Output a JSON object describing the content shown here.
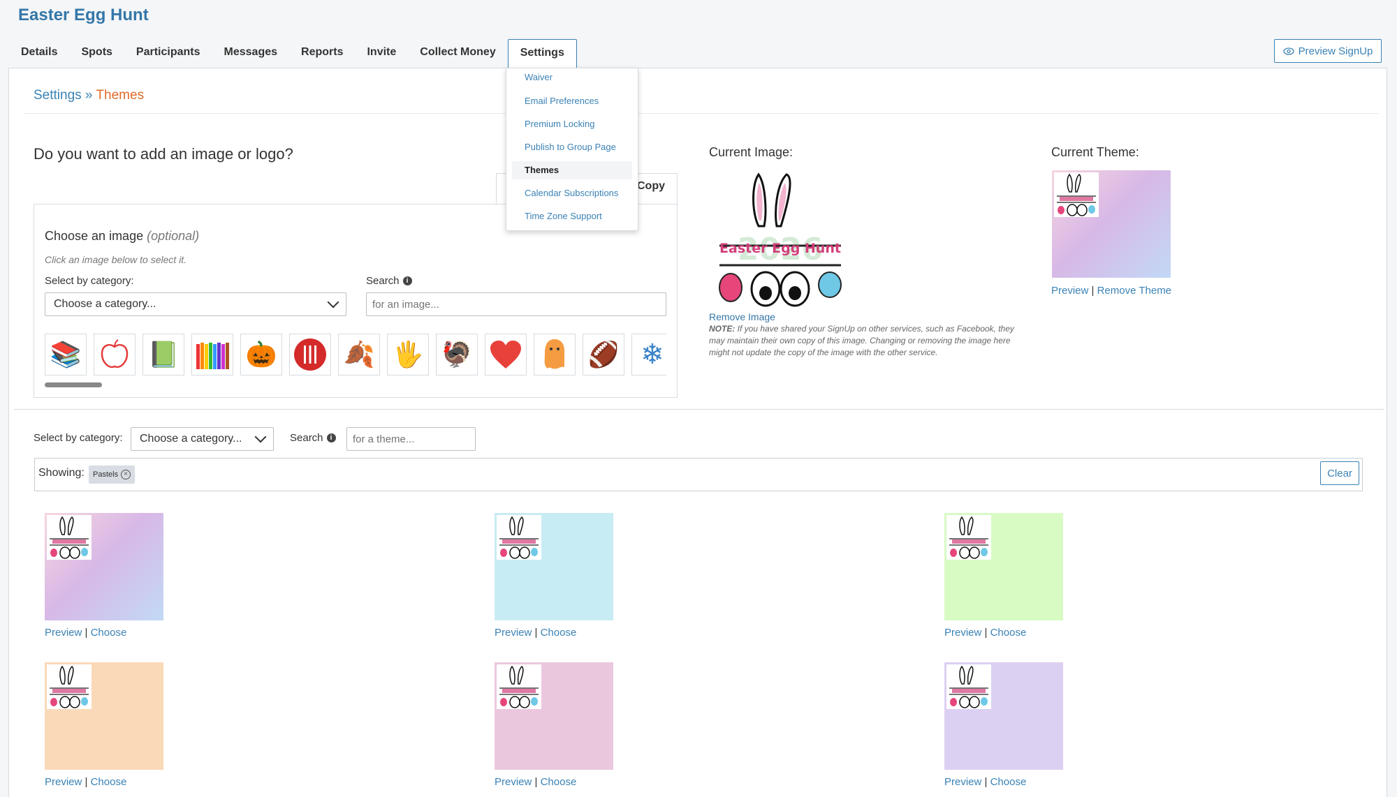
{
  "header": {
    "title": "Easter Egg Hunt",
    "preview_signup": "Preview SignUp"
  },
  "tabs": [
    {
      "label": "Details"
    },
    {
      "label": "Spots"
    },
    {
      "label": "Participants"
    },
    {
      "label": "Messages"
    },
    {
      "label": "Reports"
    },
    {
      "label": "Invite"
    },
    {
      "label": "Collect Money"
    },
    {
      "label": "Settings",
      "active": true
    }
  ],
  "settings_menu": [
    {
      "label": "Waiver"
    },
    {
      "label": "Email Preferences"
    },
    {
      "label": "Premium Locking"
    },
    {
      "label": "Publish to Group Page"
    },
    {
      "label": "Themes",
      "active": true
    },
    {
      "label": "Calendar Subscriptions"
    },
    {
      "label": "Time Zone Support"
    }
  ],
  "breadcrumb": {
    "root": "Settings",
    "sep": " » ",
    "current": "Themes"
  },
  "image_section": {
    "heading": "Do you want to add an image or logo?",
    "copy_tab": "Copy",
    "choose_title": "Choose an image ",
    "choose_optional": "(optional)",
    "hint": "Click an image below to select it.",
    "category_label": "Select by category:",
    "category_value": "Choose a category...",
    "search_label": "Search",
    "search_placeholder": "for an image...",
    "thumbs": [
      "books",
      "apple",
      "chalkboard",
      "crayons",
      "pumpkin",
      "utensils",
      "leaf",
      "handprints",
      "turkey",
      "heart",
      "ghost",
      "football",
      "snowflake"
    ]
  },
  "current_image": {
    "label": "Current Image:",
    "logo_text": "Easter Egg Hunt",
    "logo_year": "2026",
    "remove": "Remove Image",
    "note_bold": "NOTE:",
    "note": " If you have shared your SignUp on other services, such as Facebook, they may maintain their own copy of this image. Changing or removing the image here might not update the copy of the image with the other service."
  },
  "current_theme": {
    "label": "Current Theme:",
    "preview": "Preview",
    "remove": "Remove Theme"
  },
  "theme_filter": {
    "category_label": "Select by category:",
    "category_value": "Choose a category...",
    "search_label": "Search",
    "search_placeholder": "for a theme...",
    "showing_label": "Showing:",
    "pill": "Pastels",
    "clear": "Clear"
  },
  "themes": [
    {
      "preview": "Preview",
      "choose": "Choose",
      "color": "gradient-pink-purple-blue"
    },
    {
      "preview": "Preview",
      "choose": "Choose",
      "color": "#c8ecf4"
    },
    {
      "preview": "Preview",
      "choose": "Choose",
      "color": "#d8fbc4"
    },
    {
      "preview": "Preview",
      "choose": "Choose",
      "color": "#f9d9b8"
    },
    {
      "preview": "Preview",
      "choose": "Choose",
      "color": "#ebc7de"
    },
    {
      "preview": "Preview",
      "choose": "Choose",
      "color": "#dcd0f2"
    }
  ],
  "colors": {
    "link": "#3a82b5",
    "title": "#3477a8",
    "breadcrumb_current": "#e06a2a",
    "logo_pink": "#d13e7a"
  }
}
